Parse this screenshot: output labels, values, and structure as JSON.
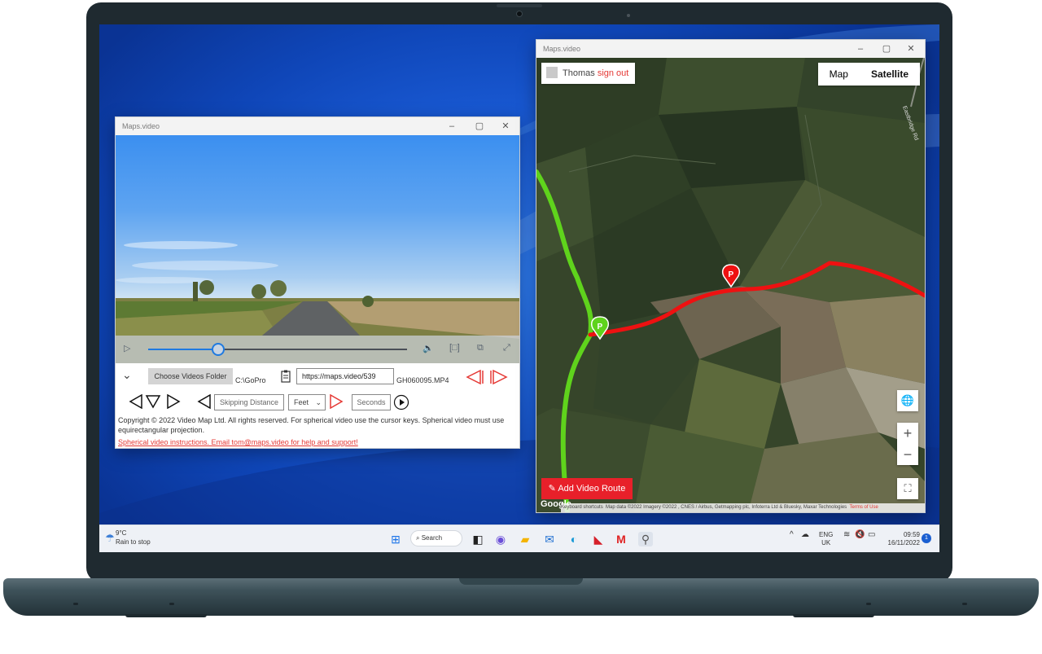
{
  "video_window": {
    "title": "Maps.video",
    "controls": {
      "progress": 0.27
    },
    "choose_folder_label": "Choose Videos Folder",
    "folder_path": "C:\\GoPro",
    "url_value": "https://maps.video/539",
    "filename": "GH060095.MP4",
    "skipping_distance_placeholder": "Skipping Distance",
    "unit_selected": "Feet",
    "seconds_placeholder": "Seconds",
    "copyright": "Copyright © 2022 Video Map Ltd. All rights reserved. For spherical video use the cursor keys. Spherical video must use equirectangular projection.",
    "help_link": "Spherical video instructions. Email tom@maps.video for help and support!"
  },
  "map_window": {
    "title": "Maps.video",
    "user_name": "Thomas",
    "sign_out_label": "sign out",
    "map_types": [
      "Map",
      "Satellite"
    ],
    "active_map_type": "Satellite",
    "road_label": "Eastbridge Rd",
    "add_route_label": "Add Video Route",
    "attribution": {
      "shortcuts": "Keyboard shortcuts",
      "data": "Map data ©2022 Imagery ©2022 , CNES / Airbus, Getmapping plc, Infoterra Ltd & Bluesky, Maxar Technologies",
      "terms": "Terms of Use"
    },
    "google_logo": "Google",
    "colors": {
      "green_route": "#5fd31c",
      "red_route": "#ee1111",
      "accent": "#e8202a"
    }
  },
  "taskbar": {
    "weather_temp": "9°C",
    "weather_desc": "Rain to stop",
    "search_label": "Search",
    "lang_line1": "ENG",
    "lang_line2": "UK",
    "time": "09:59",
    "date": "16/11/2022",
    "notification_count": "1"
  }
}
